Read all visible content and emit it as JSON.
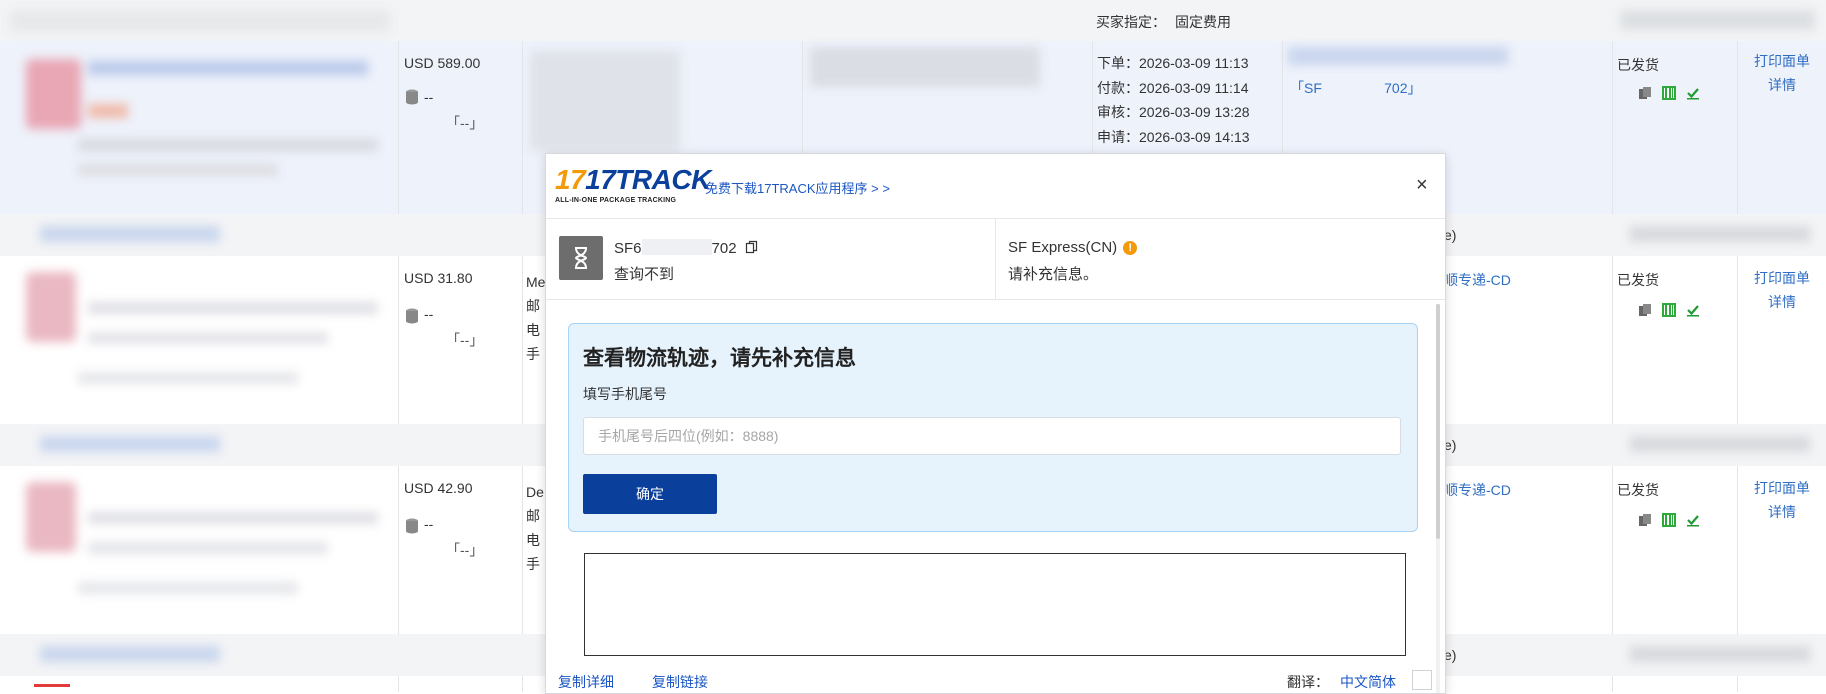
{
  "header": {
    "buyer_spec_label": "买家指定：",
    "buyer_spec_value": "固定费用"
  },
  "orders": [
    {
      "price": "USD 589.00",
      "coin_dash": "--",
      "bracket": "「--」",
      "dates": [
        "下单：2026-03-09 11:13",
        "付款：2026-03-09 11:14",
        "审核：2026-03-09 13:28",
        "申请：2026-03-09 14:13"
      ],
      "tracking_link": "「SF                702」",
      "status": "已发货",
      "print_label": "打印面单",
      "detail": "详情"
    },
    {
      "price": "USD 31.80",
      "coin_dash": "--",
      "bracket": "「--」",
      "addr_lines": [
        "Me",
        "邮",
        "电",
        "手"
      ],
      "carrier_link": "顺专递-CD",
      "status": "已发货",
      "print_label": "打印面单",
      "detail": "详情"
    },
    {
      "price": "USD 42.90",
      "coin_dash": "--",
      "bracket": "「--」",
      "addr_lines": [
        "De",
        "邮",
        "电",
        "手"
      ],
      "carrier_link": "顺专递-CD",
      "status": "已发货",
      "print_label": "打印面单",
      "detail": "详情"
    }
  ],
  "separator_suffix": "e)",
  "modal": {
    "logo_text": "17TRACK",
    "logo_tagline": "ALL-IN-ONE PACKAGE TRACKING",
    "download_link": "免费下载17TRACK应用程序 > >",
    "close_glyph": "×",
    "tracking_prefix": "SF6",
    "tracking_suffix": "702",
    "tracking_status": "查询不到",
    "carrier_name": "SF Express(CN)",
    "carrier_message": "请补充信息。",
    "info_title": "查看物流轨迹，请先补充信息",
    "phone_label": "填写手机尾号",
    "phone_placeholder": "手机尾号后四位(例如：8888)",
    "confirm_button": "确定",
    "copy_detail": "复制详细",
    "copy_link": "复制链接",
    "translate_label": "翻译：",
    "translate_value": "中文简体"
  },
  "colors": {
    "accent_blue": "#0a3f9b",
    "link_blue": "#2f6ec4",
    "orange": "#f39a0b",
    "info_bg": "#e6f3fd"
  }
}
